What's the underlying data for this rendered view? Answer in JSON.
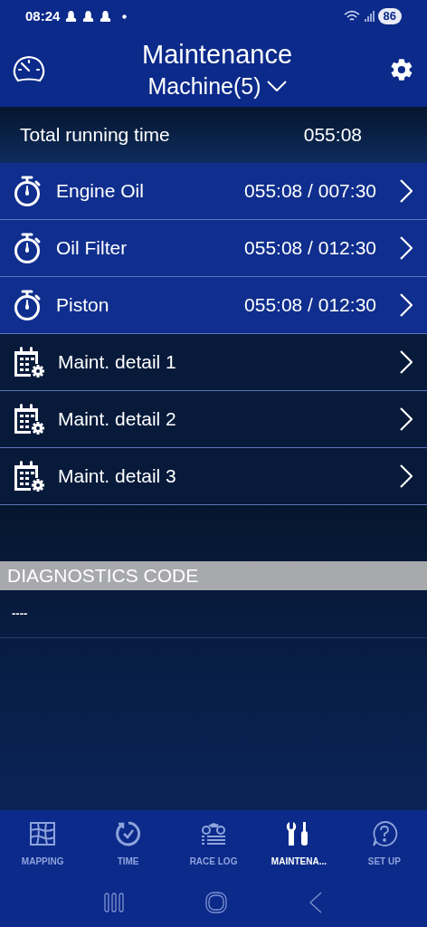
{
  "status_bar": {
    "time": "08:24",
    "battery": "86"
  },
  "header": {
    "title": "Maintenance",
    "subtitle": "Machine(5)"
  },
  "total": {
    "label": "Total running time",
    "value": "055:08"
  },
  "items": [
    {
      "kind": "timer",
      "label": "Engine Oil",
      "reading": "055:08 / 007:30"
    },
    {
      "kind": "timer",
      "label": "Oil Filter",
      "reading": "055:08 / 012:30"
    },
    {
      "kind": "timer",
      "label": "Piston",
      "reading": "055:08 / 012:30"
    },
    {
      "kind": "calendar",
      "label": "Maint. detail 1"
    },
    {
      "kind": "calendar",
      "label": "Maint. detail 2"
    },
    {
      "kind": "calendar",
      "label": "Maint. detail 3"
    }
  ],
  "diagnostics": {
    "heading": "DIAGNOSTICS CODE",
    "code": "----"
  },
  "tabs": [
    {
      "label": "MAPPING",
      "selected": false
    },
    {
      "label": "TIME",
      "selected": false
    },
    {
      "label": "RACE LOG",
      "selected": false
    },
    {
      "label": "MAINTENA...",
      "selected": true
    },
    {
      "label": "SET UP",
      "selected": false
    }
  ]
}
